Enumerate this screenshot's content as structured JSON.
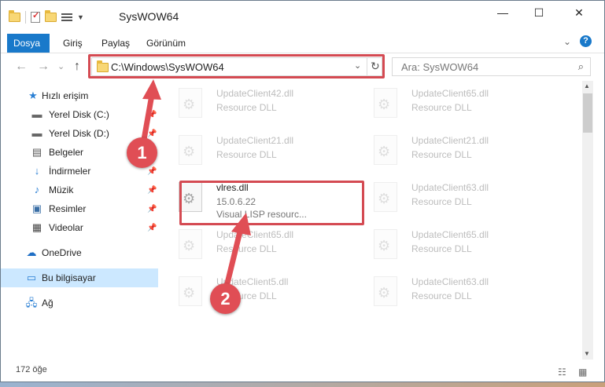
{
  "window": {
    "title": "SysWOW64",
    "controls": {
      "minimize": "—",
      "maximize": "☐",
      "close": "✕"
    }
  },
  "ribbon": {
    "tabs": [
      {
        "label": "Dosya",
        "active": true
      },
      {
        "label": "Giriş",
        "active": false
      },
      {
        "label": "Paylaş",
        "active": false
      },
      {
        "label": "Görünüm",
        "active": false
      }
    ],
    "expand_icon": "chevron-down-icon",
    "help": "?"
  },
  "navbar": {
    "back": "←",
    "forward": "→",
    "recent": "⌄",
    "up": "↑",
    "address": "C:\\Windows\\SysWOW64",
    "search_placeholder": "Ara: SysWOW64"
  },
  "sidebar": {
    "items": [
      {
        "label": "Hızlı erişim",
        "icon": "star-icon",
        "pinned": false
      },
      {
        "label": "Yerel Disk (C:)",
        "icon": "drive-icon",
        "pinned": true
      },
      {
        "label": "Yerel Disk (D:)",
        "icon": "drive-icon",
        "pinned": true
      },
      {
        "label": "Belgeler",
        "icon": "documents-icon",
        "pinned": true
      },
      {
        "label": "İndirmeler",
        "icon": "download-icon",
        "pinned": true
      },
      {
        "label": "Müzik",
        "icon": "music-icon",
        "pinned": true
      },
      {
        "label": "Resimler",
        "icon": "pictures-icon",
        "pinned": true
      },
      {
        "label": "Videolar",
        "icon": "video-icon",
        "pinned": true
      },
      {
        "label": "OneDrive",
        "icon": "cloud-icon",
        "pinned": false
      },
      {
        "label": "Bu bilgisayar",
        "icon": "computer-icon",
        "pinned": false,
        "selected": true
      },
      {
        "label": "Ağ",
        "icon": "network-icon",
        "pinned": false
      }
    ]
  },
  "files": [
    {
      "name": "UpdateClient42.dll",
      "sub": "Resource DLL"
    },
    {
      "name": "UpdateClient65.dll",
      "sub": "Resource DLL"
    },
    {
      "name": "UpdateClient21.dll",
      "sub": "Resource DLL"
    },
    {
      "name": "UpdateClient21.dll",
      "sub": "Resource DLL"
    },
    {
      "name": "vlres.dll",
      "sub": "15.0.6.22",
      "sub2": "Visual LISP resourc..."
    },
    {
      "name": "UpdateClient63.dll",
      "sub": "Resource DLL"
    },
    {
      "name": "UpdateClient65.dll",
      "sub": "Resource DLL"
    },
    {
      "name": "UpdateClient65.dll",
      "sub": "Resource DLL"
    },
    {
      "name": "UpdateClient5.dll",
      "sub": "Resource DLL"
    },
    {
      "name": "UpdateClient63.dll",
      "sub": "Resource DLL"
    }
  ],
  "status": {
    "count": "172 öğe"
  },
  "annotations": {
    "step1": "1",
    "step2": "2",
    "color": "#e04e55"
  }
}
